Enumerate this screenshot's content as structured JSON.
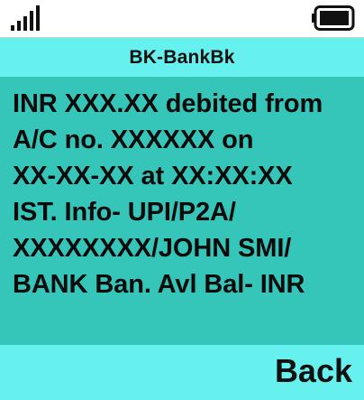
{
  "status_bar": {
    "signal_icon": "signal-bars-icon",
    "battery_icon": "battery-icon",
    "battery_level": 0.9
  },
  "header": {
    "title": "BK-BankBk"
  },
  "message": {
    "body": "INR XXX.XX debited from\nA/C no. XXXXXX on\nXX-XX-XX at XX:XX:XX\nIST. Info- UPI/P2A/\nXXXXXXXX/JOHN SMI/\nBANK Ban. Avl Bal- INR"
  },
  "softkeys": {
    "right_label": "Back"
  },
  "colors": {
    "header_bg": "#66f1ef",
    "message_bg": "#35c5b9",
    "softkey_bg": "#66f1ef"
  }
}
